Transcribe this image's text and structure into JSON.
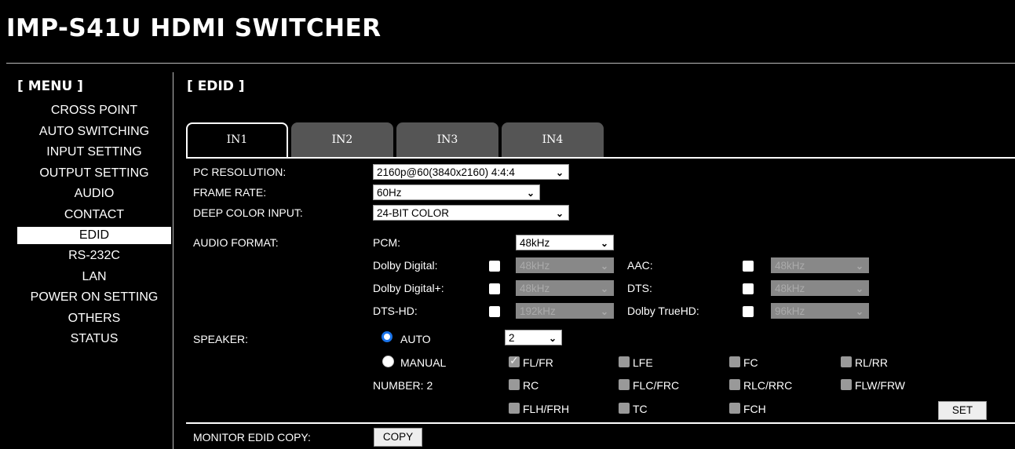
{
  "header": {
    "title": "IMP-S41U HDMI SWITCHER"
  },
  "menu": {
    "heading": "[ MENU ]",
    "items": [
      "CROSS POINT",
      "AUTO SWITCHING",
      "INPUT SETTING",
      "OUTPUT SETTING",
      "AUDIO",
      "CONTACT",
      "EDID",
      "RS-232C",
      "LAN",
      "POWER ON SETTING",
      "OTHERS",
      "STATUS"
    ],
    "active": "EDID"
  },
  "section": {
    "heading": "[ EDID ]"
  },
  "tabs": [
    "IN1",
    "IN2",
    "IN3",
    "IN4"
  ],
  "active_tab": "IN1",
  "form": {
    "pc_resolution": {
      "label": "PC RESOLUTION:",
      "value": "2160p@60(3840x2160) 4:4:4"
    },
    "frame_rate": {
      "label": "FRAME RATE:",
      "value": "60Hz"
    },
    "deep_color": {
      "label": "DEEP COLOR INPUT:",
      "value": "24-BIT COLOR"
    },
    "audio_format": {
      "label": "AUDIO FORMAT:",
      "pcm": {
        "label": "PCM:",
        "value": "48kHz"
      },
      "dolby_digital": {
        "label": "Dolby Digital:",
        "value": "48kHz"
      },
      "aac": {
        "label": "AAC:",
        "value": "48kHz"
      },
      "dolby_digital_plus": {
        "label": "Dolby Digital+:",
        "value": "48kHz"
      },
      "dts": {
        "label": "DTS:",
        "value": "48kHz"
      },
      "dts_hd": {
        "label": "DTS-HD:",
        "value": "192kHz"
      },
      "dolby_truehd": {
        "label": "Dolby TrueHD:",
        "value": "96kHz"
      }
    },
    "speaker": {
      "label": "SPEAKER:",
      "auto_label": "AUTO",
      "manual_label": "MANUAL",
      "count_value": "2",
      "number_label": "NUMBER: 2",
      "channels": [
        "FL/FR",
        "LFE",
        "FC",
        "RL/RR",
        "RC",
        "FLC/FRC",
        "RLC/RRC",
        "FLW/FRW",
        "FLH/FRH",
        "TC",
        "FCH"
      ],
      "set_label": "SET"
    },
    "monitor_copy": {
      "label": "MONITOR EDID COPY:",
      "button": "COPY"
    }
  }
}
